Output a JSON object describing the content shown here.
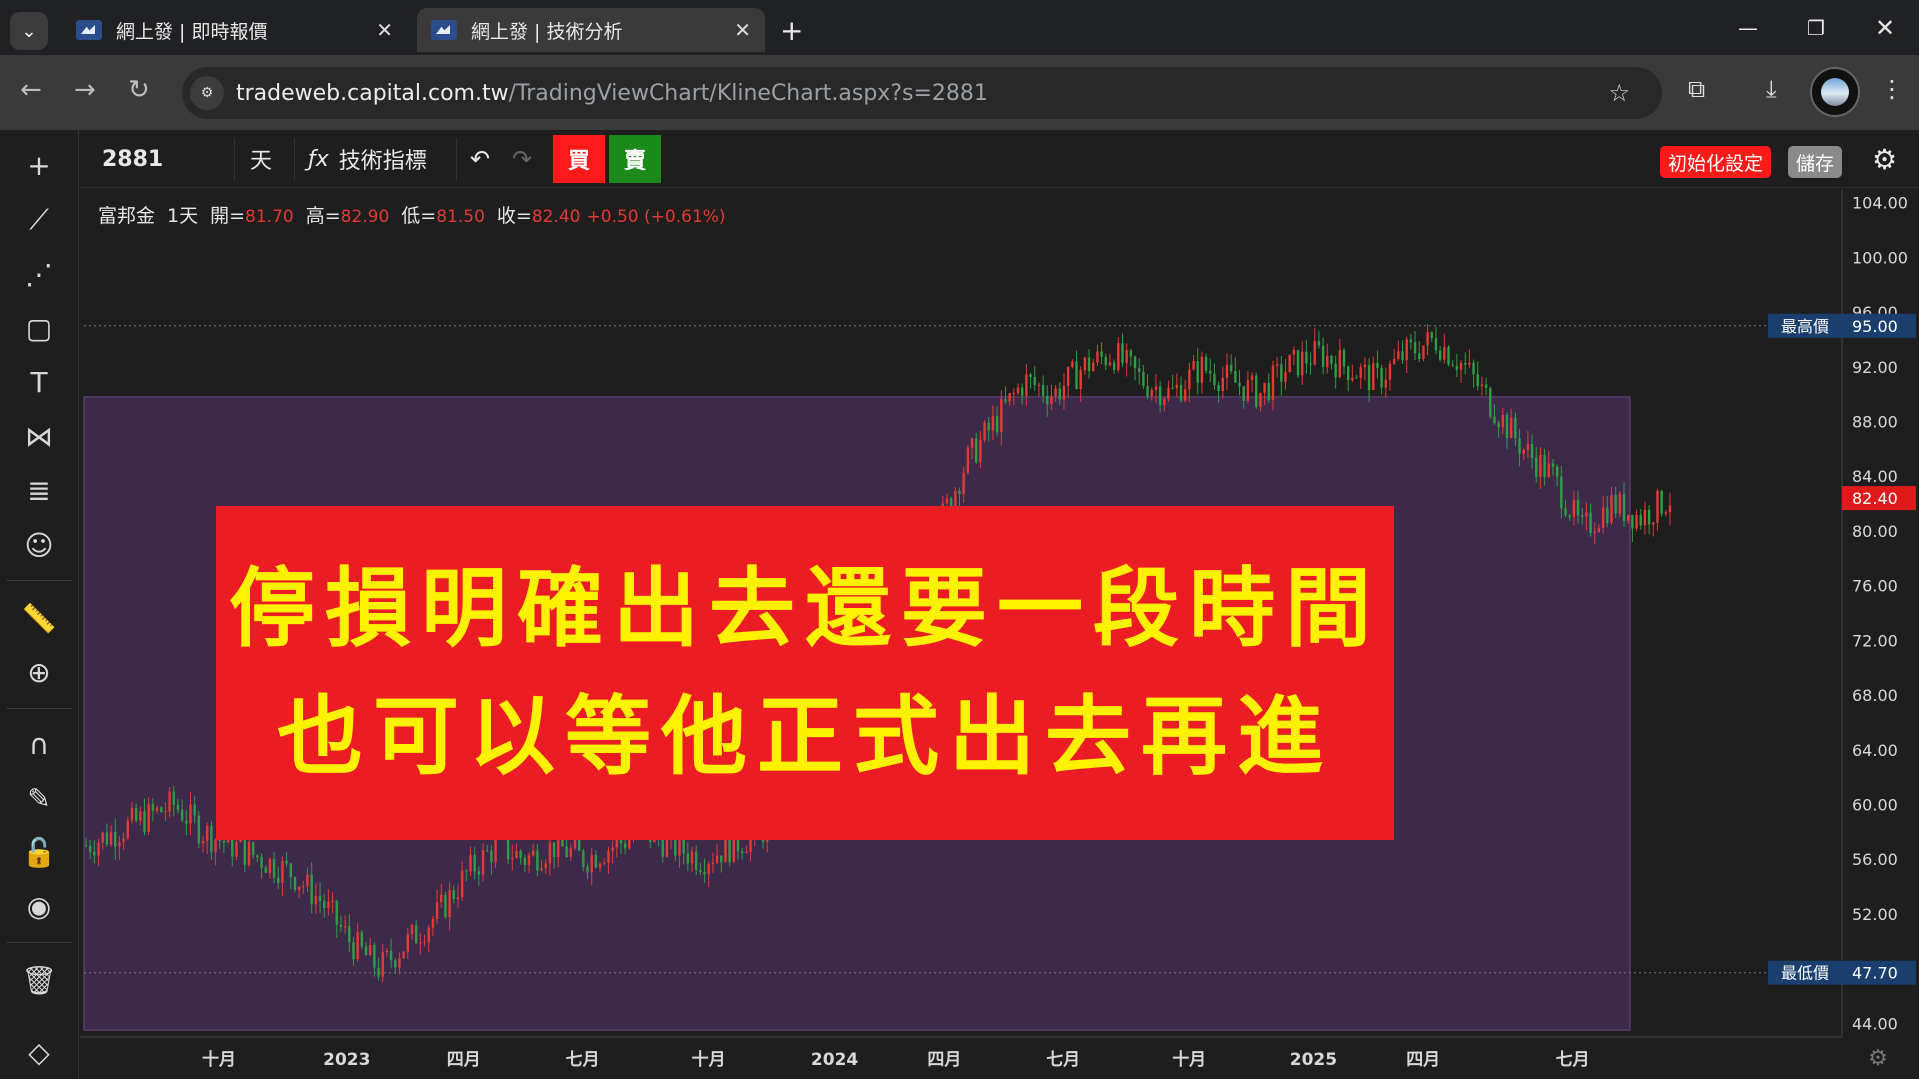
{
  "browser": {
    "tabs": [
      {
        "title": "網上發 | 即時報價",
        "active": false
      },
      {
        "title": "網上發 | 技術分析",
        "active": true
      }
    ],
    "url_host": "tradeweb.capital.com.tw",
    "url_path": "/TradingViewChart/KlineChart.aspx?s=2881"
  },
  "toolbar": {
    "symbol": "2881",
    "interval": "天",
    "indicators_label": "技術指標",
    "buy_label": "買",
    "sell_label": "賣",
    "reset_label": "初始化設定",
    "save_label": "儲存",
    "colors": {
      "buy": "#ff1a1a",
      "sell": "#1b8a1b",
      "reset": "#ff1a1a",
      "save": "#8a8a8a"
    }
  },
  "legend": {
    "name": "富邦金",
    "interval": "1天",
    "open_label": "開=",
    "open": "81.70",
    "high_label": "高=",
    "high": "82.90",
    "low_label": "低=",
    "low": "81.50",
    "close_label": "收=",
    "close": "82.40",
    "change": "+0.50 (+0.61%)"
  },
  "banner": {
    "line1": "停損明確出去還要一段時間",
    "line2": "也可以等他正式出去再進"
  },
  "price_axis": {
    "ticks": [
      "104.00",
      "100.00",
      "96.00",
      "92.00",
      "88.00",
      "84.00",
      "80.00",
      "76.00",
      "72.00",
      "68.00",
      "64.00",
      "60.00",
      "56.00",
      "52.00",
      "48.00",
      "44.00"
    ],
    "high_label": "最高價",
    "high_value": "95.00",
    "low_label": "最低價",
    "low_value": "47.70",
    "last_value": "82.40"
  },
  "time_axis": {
    "labels": [
      "十月",
      "2023",
      "四月",
      "七月",
      "十月",
      "2024",
      "四月",
      "七月",
      "十月",
      "2025",
      "四月",
      "七月"
    ]
  },
  "chart_data": {
    "type": "candlestick",
    "symbol": "2881",
    "ylim": [
      43,
      105
    ],
    "series_close": [
      57,
      58,
      59,
      60,
      58,
      57,
      56,
      55,
      53,
      50,
      48,
      50,
      52,
      55,
      57,
      56,
      57,
      56,
      57,
      58,
      57,
      56,
      57,
      58,
      60,
      63,
      65,
      70,
      75,
      80,
      85,
      88,
      91,
      90,
      92,
      93,
      91,
      90,
      92,
      91,
      90,
      92,
      93,
      92,
      91,
      93,
      94,
      92,
      89,
      86,
      84,
      80,
      82,
      81,
      82.4
    ],
    "last_close": 82.4,
    "max_price": 95.0,
    "min_price": 47.7,
    "rect_price_range": [
      43.5,
      89.8
    ],
    "colors": {
      "up": "#e53935",
      "down": "#2e9e44",
      "rect": "#3d2a4a"
    }
  }
}
